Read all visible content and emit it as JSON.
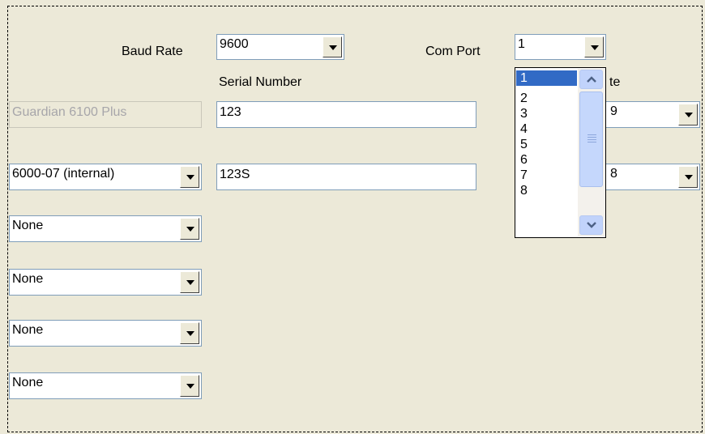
{
  "baud_rate": {
    "label": "Baud Rate",
    "value": "9600"
  },
  "com_port": {
    "label": "Com Port",
    "value": "1",
    "options": [
      "1",
      "2",
      "3",
      "4",
      "5",
      "6",
      "7",
      "8"
    ]
  },
  "serial_number_header": "Serial Number",
  "partial_header": "te",
  "rows": [
    {
      "device": "Guardian 6100 Plus",
      "serial": "123",
      "rate": "9"
    },
    {
      "device": "6000-07 (internal)",
      "serial": "123S",
      "rate": "8"
    }
  ],
  "empty_rows": [
    "None",
    "None",
    "None",
    "None"
  ]
}
